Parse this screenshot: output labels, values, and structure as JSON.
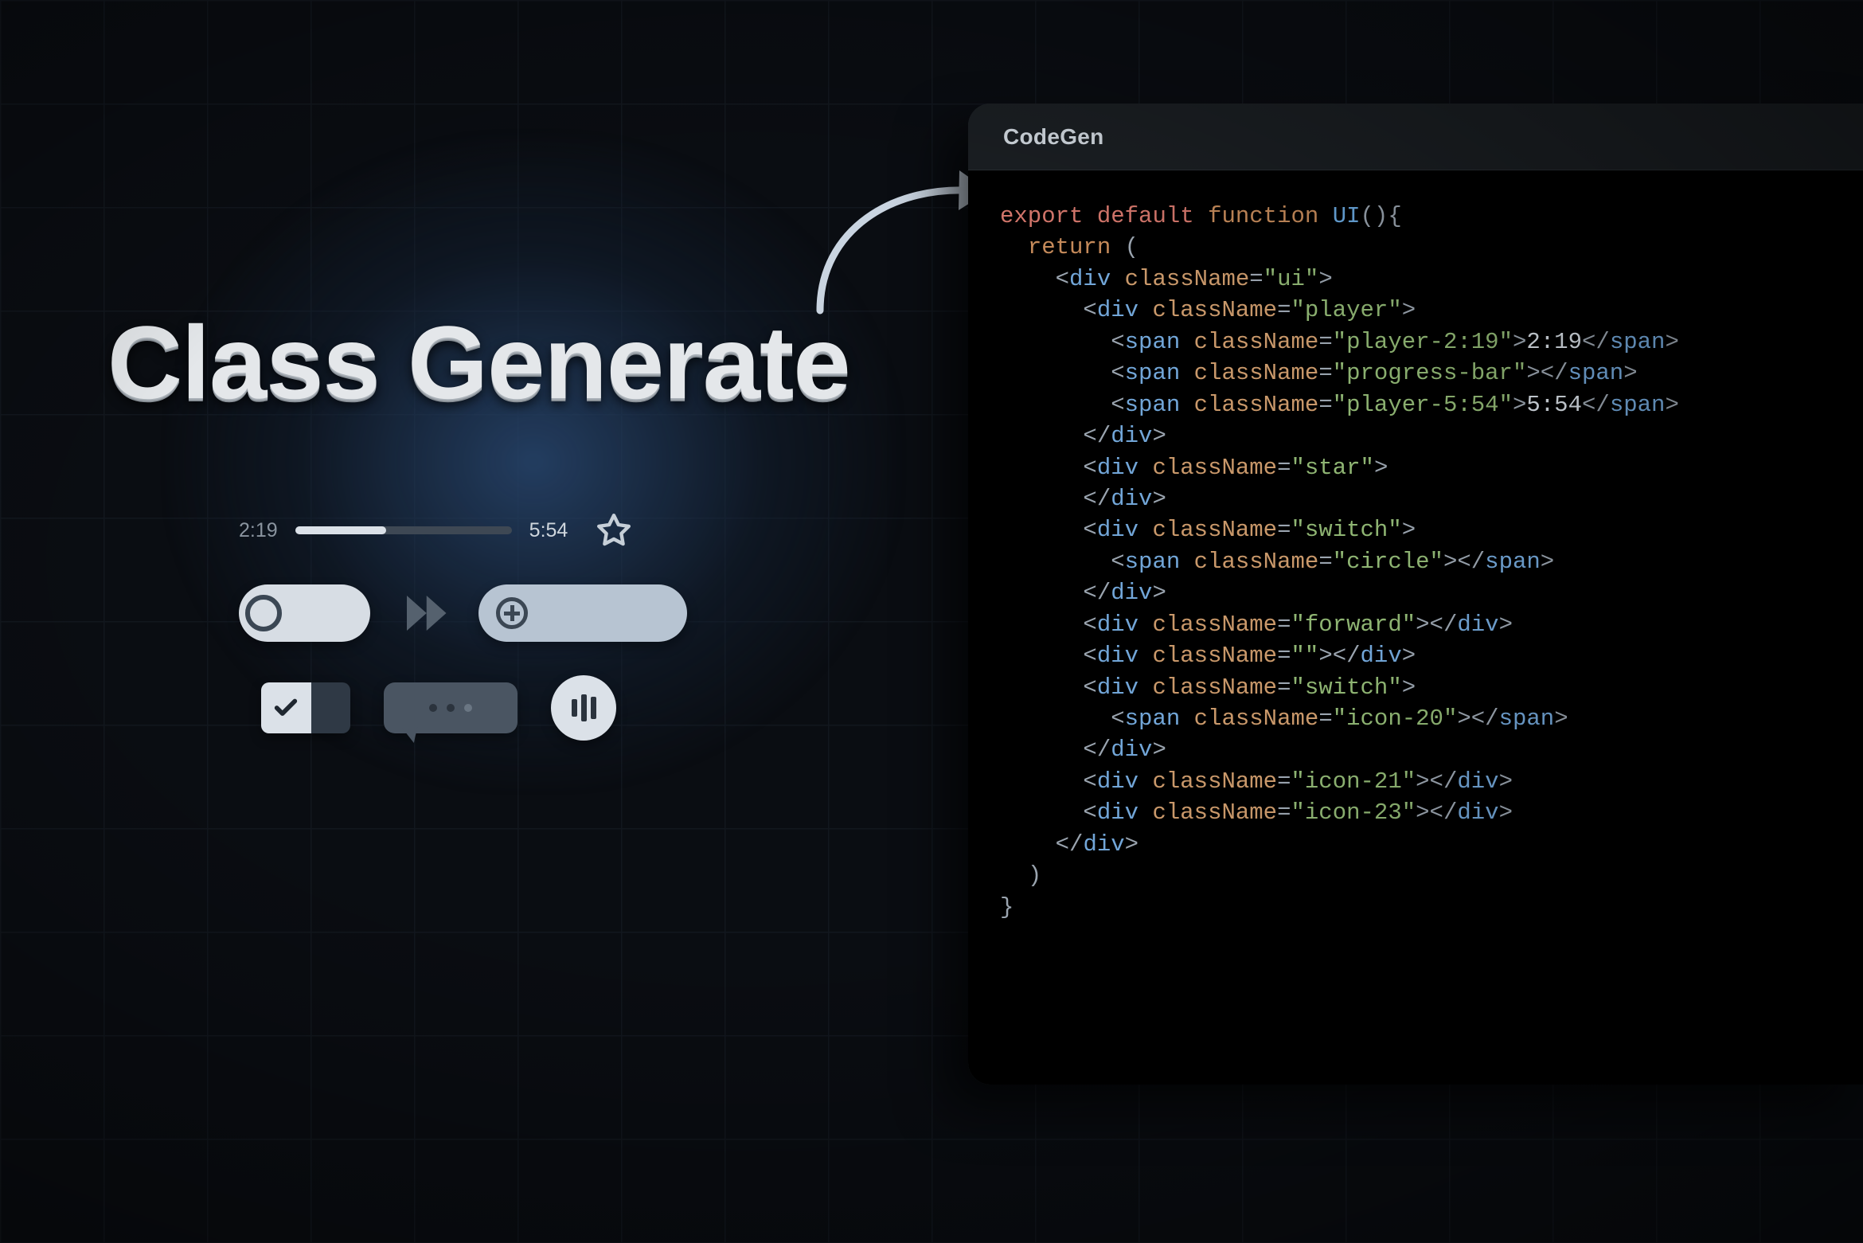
{
  "heading": "Class Generate",
  "player": {
    "current": "2:19",
    "total": "5:54",
    "progress_pct": 42
  },
  "panel": {
    "title": "CodeGen"
  },
  "code": {
    "kw_export": "export",
    "kw_default": "default",
    "kw_function": "function",
    "fn_name": "UI",
    "kw_return": "return",
    "cls_ui": "ui",
    "cls_player": "player",
    "cls_p1": "player-2:19",
    "txt_p1": "2:19",
    "cls_pb": "progress-bar",
    "cls_p2": "player-5:54",
    "txt_p2": "5:54",
    "cls_star": "star",
    "cls_switch": "switch",
    "cls_circle": "circle",
    "cls_fwd": "forward",
    "cls_empty": "",
    "cls_i20": "icon-20",
    "cls_i21": "icon-21",
    "cls_i23": "icon-23",
    "attr_classname": "className"
  }
}
